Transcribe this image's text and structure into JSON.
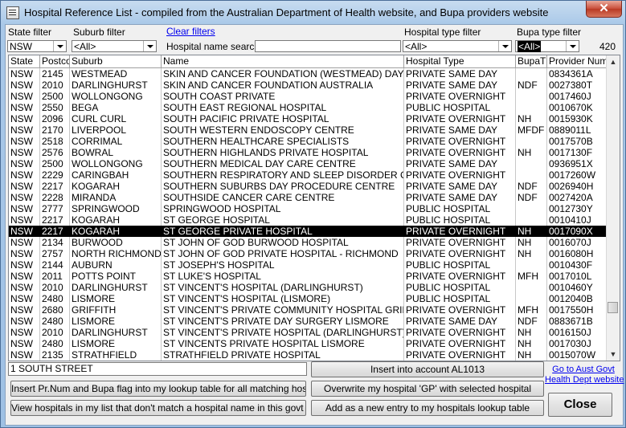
{
  "window": {
    "title": "Hospital Reference List - compiled from the Australian Department of Health website, and Bupa providers website",
    "close_glyph": "✕"
  },
  "filters": {
    "state_label": "State filter",
    "state_value": "NSW",
    "suburb_label": "Suburb filter",
    "suburb_value": "<All>",
    "clear_label": "Clear filters",
    "name_search_label": "Hospital name search",
    "name_search_value": "",
    "type_label": "Hospital type filter",
    "type_value": "<All>",
    "bupa_label": "Bupa type filter",
    "bupa_value": "<All>",
    "count": "420"
  },
  "table": {
    "columns": [
      "State",
      "Postco",
      "Suburb",
      "Name",
      "Hospital Type",
      "BupaT",
      "Provider Numbe"
    ],
    "rows": [
      [
        "NSW",
        "2145",
        "WESTMEAD",
        "SKIN AND CANCER FOUNDATION (WESTMEAD) DAY PROCEDURE",
        "PRIVATE SAME DAY",
        "",
        "0834361A"
      ],
      [
        "NSW",
        "2010",
        "DARLINGHURST",
        "SKIN AND CANCER FOUNDATION AUSTRALIA",
        "PRIVATE SAME DAY",
        "NDF",
        "0027380T"
      ],
      [
        "NSW",
        "2500",
        "WOLLONGONG",
        "SOUTH COAST PRIVATE",
        "PRIVATE OVERNIGHT",
        "",
        "0017460J"
      ],
      [
        "NSW",
        "2550",
        "BEGA",
        "SOUTH EAST REGIONAL HOSPITAL",
        "PUBLIC HOSPITAL",
        "",
        "0010670K"
      ],
      [
        "NSW",
        "2096",
        "CURL CURL",
        "SOUTH PACIFIC PRIVATE HOSPITAL",
        "PRIVATE OVERNIGHT",
        "NH",
        "0015930K"
      ],
      [
        "NSW",
        "2170",
        "LIVERPOOL",
        "SOUTH WESTERN ENDOSCOPY CENTRE",
        "PRIVATE SAME DAY",
        "MFDF",
        "0889011L"
      ],
      [
        "NSW",
        "2518",
        "CORRIMAL",
        "SOUTHERN HEALTHCARE SPECIALISTS",
        "PRIVATE OVERNIGHT",
        "",
        "0017570B"
      ],
      [
        "NSW",
        "2576",
        "BOWRAL",
        "SOUTHERN HIGHLANDS PRIVATE HOSPITAL",
        "PRIVATE OVERNIGHT",
        "NH",
        "0017130F"
      ],
      [
        "NSW",
        "2500",
        "WOLLONGONG",
        "SOUTHERN MEDICAL DAY CARE CENTRE",
        "PRIVATE SAME DAY",
        "",
        "0936951X"
      ],
      [
        "NSW",
        "2229",
        "CARINGBAH",
        "SOUTHERN RESPIRATORY AND SLEEP DISORDER CENTRE",
        "PRIVATE OVERNIGHT",
        "",
        "0017260W"
      ],
      [
        "NSW",
        "2217",
        "KOGARAH",
        "SOUTHERN SUBURBS DAY PROCEDURE CENTRE",
        "PRIVATE SAME DAY",
        "NDF",
        "0026940H"
      ],
      [
        "NSW",
        "2228",
        "MIRANDA",
        "SOUTHSIDE CANCER CARE CENTRE",
        "PRIVATE SAME DAY",
        "NDF",
        "0027420A"
      ],
      [
        "NSW",
        "2777",
        "SPRINGWOOD",
        "SPRINGWOOD HOSPITAL",
        "PUBLIC HOSPITAL",
        "",
        "0012730Y"
      ],
      [
        "NSW",
        "2217",
        "KOGARAH",
        "ST GEORGE HOSPITAL",
        "PUBLIC HOSPITAL",
        "",
        "0010410J"
      ],
      [
        "NSW",
        "2217",
        "KOGARAH",
        "ST GEORGE PRIVATE HOSPITAL",
        "PRIVATE OVERNIGHT",
        "NH",
        "0017090X"
      ],
      [
        "NSW",
        "2134",
        "BURWOOD",
        "ST JOHN OF GOD BURWOOD HOSPITAL",
        "PRIVATE OVERNIGHT",
        "NH",
        "0016070J"
      ],
      [
        "NSW",
        "2757",
        "NORTH RICHMOND",
        "ST JOHN OF GOD PRIVATE HOSPITAL - RICHMOND",
        "PRIVATE OVERNIGHT",
        "NH",
        "0016080H"
      ],
      [
        "NSW",
        "2144",
        "AUBURN",
        "ST JOSEPH'S HOSPITAL",
        "PUBLIC HOSPITAL",
        "",
        "0010430F"
      ],
      [
        "NSW",
        "2011",
        "POTTS POINT",
        "ST LUKE'S HOSPITAL",
        "PRIVATE OVERNIGHT",
        "MFH",
        "0017010L"
      ],
      [
        "NSW",
        "2010",
        "DARLINGHURST",
        "ST VINCENT'S HOSPITAL (DARLINGHURST)",
        "PUBLIC HOSPITAL",
        "",
        "0010460Y"
      ],
      [
        "NSW",
        "2480",
        "LISMORE",
        "ST VINCENT'S HOSPITAL (LISMORE)",
        "PUBLIC HOSPITAL",
        "",
        "0012040B"
      ],
      [
        "NSW",
        "2680",
        "GRIFFITH",
        "ST VINCENT'S PRIVATE COMMUNITY HOSPITAL GRIFFITH",
        "PRIVATE OVERNIGHT",
        "MFH",
        "0017550H"
      ],
      [
        "NSW",
        "2480",
        "LISMORE",
        "ST VINCENT'S PRIVATE DAY SURGERY LISMORE",
        "PRIVATE SAME DAY",
        "NDF",
        "0883671B"
      ],
      [
        "NSW",
        "2010",
        "DARLINGHURST",
        "ST VINCENT'S PRIVATE HOSPITAL (DARLINGHURST)",
        "PRIVATE OVERNIGHT",
        "NH",
        "0016150J"
      ],
      [
        "NSW",
        "2480",
        "LISMORE",
        "ST VINCENTS PRIVATE HOSPITAL LISMORE",
        "PRIVATE OVERNIGHT",
        "NH",
        "0017030J"
      ],
      [
        "NSW",
        "2135",
        "STRATHFIELD",
        "STRATHFIELD PRIVATE HOSPITAL",
        "PRIVATE OVERNIGHT",
        "NH",
        "0015070W"
      ]
    ]
  },
  "footer": {
    "address": "1 SOUTH STREET",
    "insert_account": "Insert into account AL1013",
    "link_line1": "Go to Aust Govt",
    "link_line2": "Health Dept website",
    "insert_prnum": "Insert Pr.Num and Bupa flag into my lookup table for all matching hospitals",
    "overwrite_gp": "Overwrite my hospital 'GP' with selected hospital",
    "close": "Close",
    "view_unmatched": "View hospitals in my list that don't match a hospital name in this govt list",
    "add_entry": "Add as a new entry to my hospitals lookup table"
  }
}
